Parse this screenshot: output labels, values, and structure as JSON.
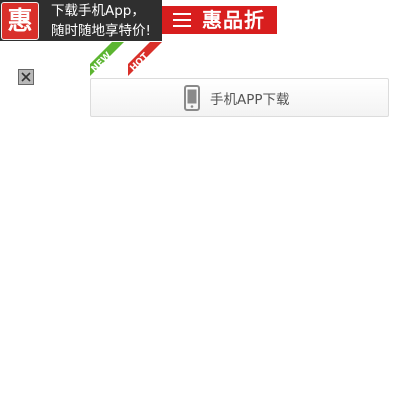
{
  "promo_banner": {
    "logo_char": "惠",
    "line1": "下载手机App，",
    "line2": "随时随地享特价!"
  },
  "header": {
    "menu_icon": "hamburger-menu-icon",
    "brand": "惠品折"
  },
  "ribbons": [
    {
      "label": "NEW",
      "color": "#5cb531"
    },
    {
      "label": "HOT",
      "color": "#d9302a"
    }
  ],
  "broken_image_icon": "broken-image-icon",
  "download_button": {
    "icon": "mobile-phone-icon",
    "label": "手机APP下载"
  },
  "colors": {
    "brand_red": "#d81e1e",
    "banner_dark": "#2f2f2f",
    "new_green": "#5cb531",
    "hot_red": "#d9302a"
  }
}
